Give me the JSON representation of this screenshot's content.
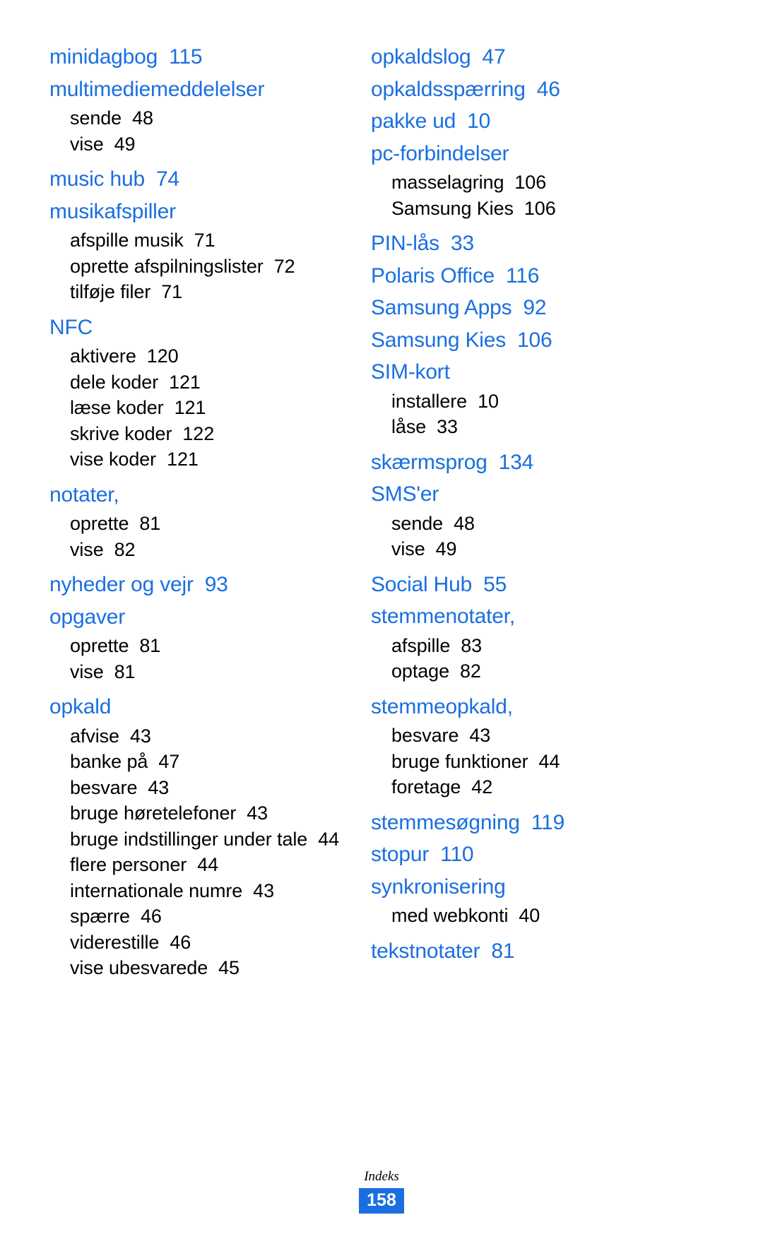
{
  "document": {
    "type": "index-page",
    "language": "da",
    "accent_color": "#1a6fe0",
    "body_color": "#000000",
    "background_color": "#ffffff"
  },
  "footer": {
    "label": "Indeks",
    "page_number": "158"
  },
  "columns": [
    {
      "name": "left-column",
      "entries": [
        {
          "level": "main",
          "term": "minidagbog",
          "page": "115"
        },
        {
          "level": "main",
          "term": "multimediemeddelelser",
          "page": ""
        },
        {
          "level": "sub",
          "term": "sende",
          "page": "48"
        },
        {
          "level": "sub",
          "term": "vise",
          "page": "49"
        },
        {
          "level": "main",
          "term": "music hub",
          "page": "74"
        },
        {
          "level": "main",
          "term": "musikafspiller",
          "page": ""
        },
        {
          "level": "sub",
          "term": "afspille musik",
          "page": "71"
        },
        {
          "level": "sub",
          "term": "oprette afspilningslister",
          "page": "72"
        },
        {
          "level": "sub",
          "term": "tilføje filer",
          "page": "71"
        },
        {
          "level": "main",
          "term": "NFC",
          "page": ""
        },
        {
          "level": "sub",
          "term": "aktivere",
          "page": "120"
        },
        {
          "level": "sub",
          "term": "dele koder",
          "page": "121"
        },
        {
          "level": "sub",
          "term": "læse koder",
          "page": "121"
        },
        {
          "level": "sub",
          "term": "skrive koder",
          "page": "122"
        },
        {
          "level": "sub",
          "term": "vise koder",
          "page": "121"
        },
        {
          "level": "main",
          "term": "notater,",
          "page": ""
        },
        {
          "level": "sub",
          "term": "oprette",
          "page": "81"
        },
        {
          "level": "sub",
          "term": "vise",
          "page": "82"
        },
        {
          "level": "main",
          "term": "nyheder og vejr",
          "page": "93"
        },
        {
          "level": "main",
          "term": "opgaver",
          "page": ""
        },
        {
          "level": "sub",
          "term": "oprette",
          "page": "81"
        },
        {
          "level": "sub",
          "term": "vise",
          "page": "81"
        },
        {
          "level": "main",
          "term": "opkald",
          "page": ""
        },
        {
          "level": "sub",
          "term": "afvise",
          "page": "43"
        },
        {
          "level": "sub",
          "term": "banke på",
          "page": "47"
        },
        {
          "level": "sub",
          "term": "besvare",
          "page": "43"
        },
        {
          "level": "sub",
          "term": "bruge høretelefoner",
          "page": "43"
        },
        {
          "level": "sub",
          "term": "bruge indstillinger under tale",
          "page": "44",
          "wraps": true
        },
        {
          "level": "sub",
          "term": "flere personer",
          "page": "44"
        },
        {
          "level": "sub",
          "term": "internationale numre",
          "page": "43"
        },
        {
          "level": "sub",
          "term": "spærre",
          "page": "46"
        },
        {
          "level": "sub",
          "term": "viderestille",
          "page": "46"
        },
        {
          "level": "sub",
          "term": "vise ubesvarede",
          "page": "45"
        }
      ]
    },
    {
      "name": "right-column",
      "entries": [
        {
          "level": "main",
          "term": "opkaldslog",
          "page": "47"
        },
        {
          "level": "main",
          "term": "opkaldsspærring",
          "page": "46"
        },
        {
          "level": "main",
          "term": "pakke ud",
          "page": "10"
        },
        {
          "level": "main",
          "term": "pc-forbindelser",
          "page": ""
        },
        {
          "level": "sub",
          "term": "masselagring",
          "page": "106"
        },
        {
          "level": "sub",
          "term": "Samsung Kies",
          "page": "106"
        },
        {
          "level": "main",
          "term": "PIN-lås",
          "page": "33"
        },
        {
          "level": "main",
          "term": "Polaris Office",
          "page": "116"
        },
        {
          "level": "main",
          "term": "Samsung Apps",
          "page": "92"
        },
        {
          "level": "main",
          "term": "Samsung Kies",
          "page": "106"
        },
        {
          "level": "main",
          "term": "SIM-kort",
          "page": ""
        },
        {
          "level": "sub",
          "term": "installere",
          "page": "10"
        },
        {
          "level": "sub",
          "term": "låse",
          "page": "33"
        },
        {
          "level": "main",
          "term": "skærmsprog",
          "page": "134"
        },
        {
          "level": "main",
          "term": "SMS'er",
          "page": ""
        },
        {
          "level": "sub",
          "term": "sende",
          "page": "48"
        },
        {
          "level": "sub",
          "term": "vise",
          "page": "49"
        },
        {
          "level": "main",
          "term": "Social Hub",
          "page": "55"
        },
        {
          "level": "main",
          "term": "stemmenotater,",
          "page": ""
        },
        {
          "level": "sub",
          "term": "afspille",
          "page": "83"
        },
        {
          "level": "sub",
          "term": "optage",
          "page": "82"
        },
        {
          "level": "main",
          "term": "stemmeopkald,",
          "page": ""
        },
        {
          "level": "sub",
          "term": "besvare",
          "page": "43"
        },
        {
          "level": "sub",
          "term": "bruge funktioner",
          "page": "44"
        },
        {
          "level": "sub",
          "term": "foretage",
          "page": "42"
        },
        {
          "level": "main",
          "term": "stemmesøgning",
          "page": "119"
        },
        {
          "level": "main",
          "term": "stopur",
          "page": "110"
        },
        {
          "level": "main",
          "term": "synkronisering",
          "page": ""
        },
        {
          "level": "sub",
          "term": "med webkonti",
          "page": "40"
        },
        {
          "level": "main",
          "term": "tekstnotater",
          "page": "81"
        }
      ]
    }
  ]
}
